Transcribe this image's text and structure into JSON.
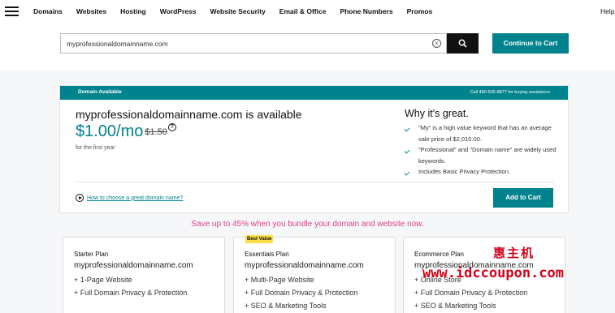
{
  "nav": {
    "items": [
      "Domains",
      "Websites",
      "Hosting",
      "WordPress",
      "Website Security",
      "Email & Office",
      "Phone Numbers",
      "Promos"
    ],
    "help": "Help"
  },
  "search": {
    "value": "myprofessionaldomainname.com",
    "clear_symbol": "×",
    "cart_label": "Continue to Cart"
  },
  "card": {
    "header_title": "Domain Available",
    "header_call": "Call 480-505-8877 for buying assistance",
    "domain_headline": "myprofessionaldomainname.com is available",
    "price": "$1.00/mo",
    "old_price": "$1.50",
    "help_symbol": "?",
    "term": "for the first year",
    "why_title": "Why it's great.",
    "why_items": [
      "\"My\" is a high value keyword that has an average sale price of $2,010.00.",
      "\"Professional\" and \"Domain name\" are widely used keywords.",
      "Includes Basic Privacy Protection."
    ],
    "howto_link": "How to choose a great domain name?",
    "add_to_cart": "Add to Cart"
  },
  "bundle_text": "Save up to 45% when you bundle your domain and website now.",
  "plans": [
    {
      "name": "Starter Plan",
      "domain": "myprofessionaldomainname.com",
      "features": [
        "+ 1-Page Website",
        "+ Full Domain Privacy & Protection"
      ]
    },
    {
      "name": "Essentials Plan",
      "badge": "Best Value",
      "domain": "myprofessionaldomainname.com",
      "features": [
        "+ Multi-Page Website",
        "+ Full Domain Privacy & Protection",
        "+ SEO & Marketing Tools"
      ]
    },
    {
      "name": "Ecommerce Plan",
      "domain": "myprofessionaldomainname.com",
      "features": [
        "+ Online Store",
        "+ Full Domain Privacy & Protection",
        "+ SEO & Marketing Tools"
      ]
    }
  ],
  "watermark": {
    "cn": "惠主机",
    "url": "www.idccoupon.com"
  },
  "colors": {
    "brand": "#00838c",
    "promo": "#e0418a",
    "badge": "#fedc45"
  }
}
